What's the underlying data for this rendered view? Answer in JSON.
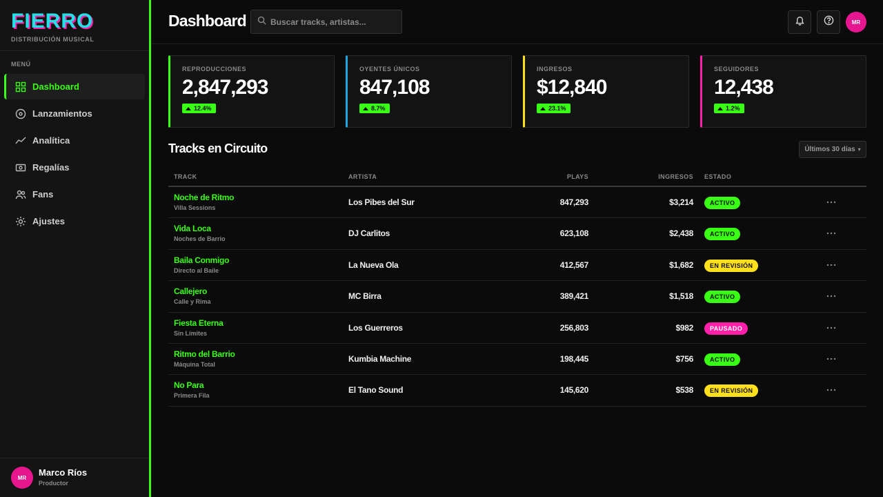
{
  "app": {
    "logo": "FIERRO",
    "tagline": "DISTRIBUCIÓN MUSICAL"
  },
  "sidebar": {
    "menu_label": "MENÚ",
    "items": [
      {
        "label": "Dashboard",
        "icon": "grid-icon",
        "active": true
      },
      {
        "label": "Lanzamientos",
        "icon": "disc-icon",
        "active": false
      },
      {
        "label": "Analítica",
        "icon": "trend-icon",
        "active": false
      },
      {
        "label": "Regalías",
        "icon": "money-icon",
        "active": false
      },
      {
        "label": "Fans",
        "icon": "users-icon",
        "active": false
      },
      {
        "label": "Ajustes",
        "icon": "gear-icon",
        "active": false
      }
    ],
    "user": {
      "initials": "MR",
      "name": "Marco Ríos",
      "role": "Productor"
    }
  },
  "header": {
    "title": "Dashboard",
    "search_placeholder": "Buscar tracks, artistas...",
    "avatar_initials": "MR"
  },
  "stats": [
    {
      "label": "REPRODUCCIONES",
      "value": "2,847,293",
      "delta": "12.4%",
      "accent": "#39ff14"
    },
    {
      "label": "OYENTES ÚNICOS",
      "value": "847,108",
      "delta": "8.7%",
      "accent": "#1fa8e0"
    },
    {
      "label": "INGRESOS",
      "value": "$12,840",
      "delta": "23.1%",
      "accent": "#ffe01a"
    },
    {
      "label": "SEGUIDORES",
      "value": "12,438",
      "delta": "1.2%",
      "accent": "#ff1fa8"
    }
  ],
  "tracks_section": {
    "title": "Tracks en Circuito",
    "range": "Últimos 30 días",
    "columns": {
      "track": "TRACK",
      "artist": "ARTISTA",
      "plays": "PLAYS",
      "revenue": "INGRESOS",
      "status": "ESTADO"
    },
    "rows": [
      {
        "title": "Noche de Ritmo",
        "album": "Villa Sessions",
        "artist": "Los Pibes del Sur",
        "plays": "847,293",
        "revenue": "$3,214",
        "status": "ACTIVO",
        "status_kind": "activo"
      },
      {
        "title": "Vida Loca",
        "album": "Noches de Barrio",
        "artist": "DJ Carlitos",
        "plays": "623,108",
        "revenue": "$2,438",
        "status": "ACTIVO",
        "status_kind": "activo"
      },
      {
        "title": "Baila Conmigo",
        "album": "Directo al Baile",
        "artist": "La Nueva Ola",
        "plays": "412,567",
        "revenue": "$1,682",
        "status": "EN REVISIÓN",
        "status_kind": "revision"
      },
      {
        "title": "Callejero",
        "album": "Calle y Rima",
        "artist": "MC Birra",
        "plays": "389,421",
        "revenue": "$1,518",
        "status": "ACTIVO",
        "status_kind": "activo"
      },
      {
        "title": "Fiesta Eterna",
        "album": "Sin Límites",
        "artist": "Los Guerreros",
        "plays": "256,803",
        "revenue": "$982",
        "status": "PAUSADO",
        "status_kind": "pausado"
      },
      {
        "title": "Ritmo del Barrio",
        "album": "Máquina Total",
        "artist": "Kumbia Machine",
        "plays": "198,445",
        "revenue": "$756",
        "status": "ACTIVO",
        "status_kind": "activo"
      },
      {
        "title": "No Para",
        "album": "Primera Fila",
        "artist": "El Tano Sound",
        "plays": "145,620",
        "revenue": "$538",
        "status": "EN REVISIÓN",
        "status_kind": "revision"
      }
    ]
  }
}
